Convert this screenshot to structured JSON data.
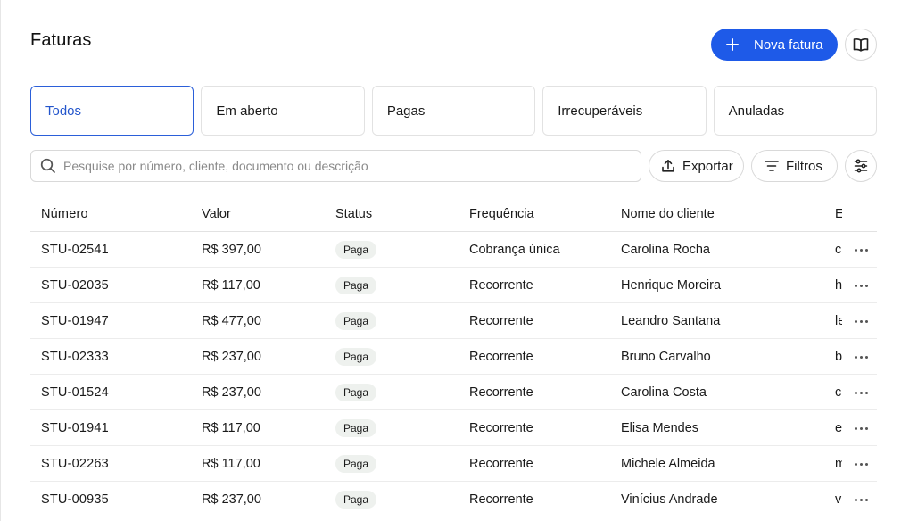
{
  "page": {
    "title": "Faturas"
  },
  "header": {
    "new_button_label": "Nova fatura",
    "new_button_icon": "plus-icon",
    "docs_icon": "book-icon"
  },
  "tabs": [
    {
      "label": "Todos",
      "active": true
    },
    {
      "label": "Em aberto",
      "active": false
    },
    {
      "label": "Pagas",
      "active": false
    },
    {
      "label": "Irrecuperáveis",
      "active": false
    },
    {
      "label": "Anuladas",
      "active": false
    }
  ],
  "toolbar": {
    "search_placeholder": "Pesquise por número, cliente, documento ou descrição",
    "export_label": "Exportar",
    "filters_label": "Filtros"
  },
  "colors": {
    "accent": "#1e5ae8",
    "active_tab_border": "#2b5fd9",
    "badge_bg": "#eef1ee"
  },
  "table": {
    "columns": [
      "Número",
      "Valor",
      "Status",
      "Frequência",
      "Nome do cliente",
      "E"
    ],
    "rows": [
      {
        "number": "STU-02541",
        "value": "R$ 397,00",
        "status": "Paga",
        "frequency": "Cobrança única",
        "client": "Carolina Rocha",
        "email": "c"
      },
      {
        "number": "STU-02035",
        "value": "R$ 117,00",
        "status": "Paga",
        "frequency": "Recorrente",
        "client": "Henrique Moreira",
        "email": "h"
      },
      {
        "number": "STU-01947",
        "value": "R$ 477,00",
        "status": "Paga",
        "frequency": "Recorrente",
        "client": "Leandro Santana",
        "email": "le"
      },
      {
        "number": "STU-02333",
        "value": "R$ 237,00",
        "status": "Paga",
        "frequency": "Recorrente",
        "client": "Bruno Carvalho",
        "email": "b"
      },
      {
        "number": "STU-01524",
        "value": "R$ 237,00",
        "status": "Paga",
        "frequency": "Recorrente",
        "client": "Carolina Costa",
        "email": "c"
      },
      {
        "number": "STU-01941",
        "value": "R$ 117,00",
        "status": "Paga",
        "frequency": "Recorrente",
        "client": "Elisa Mendes",
        "email": "e"
      },
      {
        "number": "STU-02263",
        "value": "R$ 117,00",
        "status": "Paga",
        "frequency": "Recorrente",
        "client": "Michele Almeida",
        "email": "m"
      },
      {
        "number": "STU-00935",
        "value": "R$ 237,00",
        "status": "Paga",
        "frequency": "Recorrente",
        "client": "Vinícius Andrade",
        "email": "v"
      }
    ]
  }
}
